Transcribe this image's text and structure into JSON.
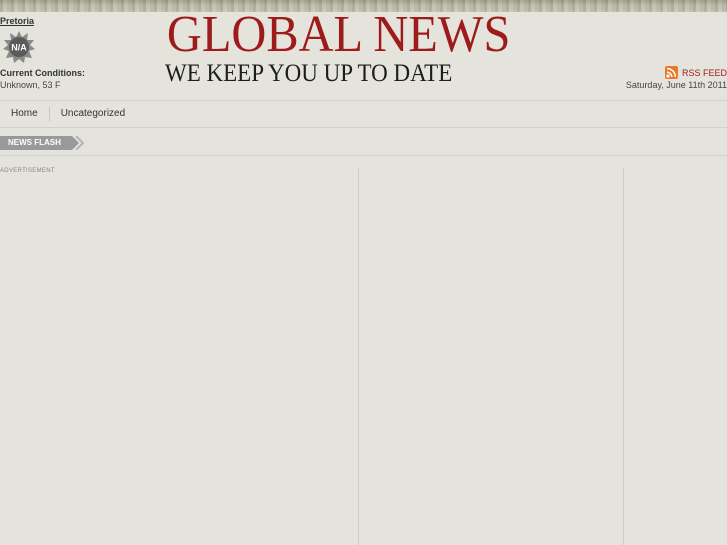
{
  "header": {
    "city": "Pretoria",
    "weather_icon_text": "N/A",
    "conditions_label": "Current Conditions:",
    "conditions_value": "Unknown, 53 F",
    "logo_title": "GLOBAL NEWS",
    "logo_tagline": "WE KEEP YOU UP TO DATE",
    "rss_label": "RSS FEED",
    "date": "Saturday, June 11th 2011"
  },
  "nav": {
    "items": [
      {
        "label": "Home"
      },
      {
        "label": "Uncategorized"
      }
    ]
  },
  "news_flash": {
    "label": "NEWS FLASH"
  },
  "content": {
    "ad_label": "ADVERTISEMENT"
  },
  "icons": {
    "weather": "weather-na-icon",
    "rss": "rss-icon"
  },
  "colors": {
    "brand": "#9e1b1b",
    "background": "#e4e3dd",
    "flash_tag": "#999999",
    "rss": "#e77b2b"
  }
}
